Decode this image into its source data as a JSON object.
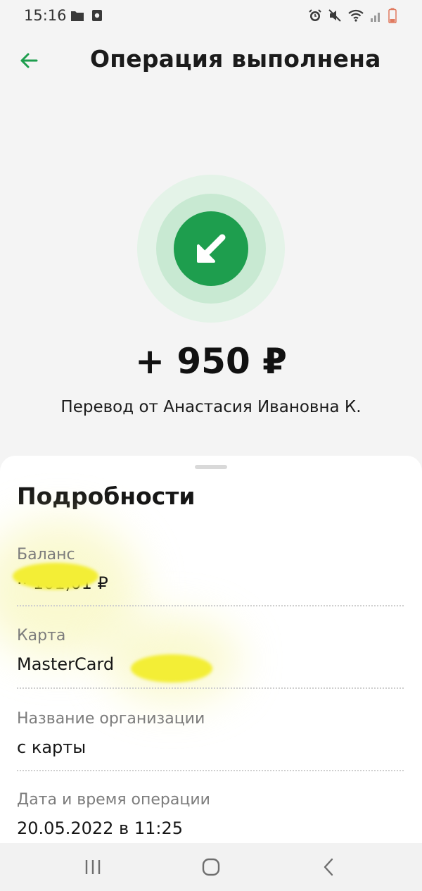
{
  "status": {
    "time": "15:16",
    "left_icons": [
      "folder-icon",
      "media-icon"
    ],
    "right_icons": [
      "alarm-icon",
      "mute-icon",
      "wifi-icon",
      "signal-icon",
      "battery-icon"
    ]
  },
  "header": {
    "back_icon": "arrow-left-icon",
    "title": "Операция выполнена"
  },
  "hero": {
    "icon": "incoming-arrow-icon",
    "amount": "+ 950 ₽",
    "subtitle": "Перевод от Анастасия Ивановна К."
  },
  "details": {
    "title": "Подробности",
    "rows": [
      {
        "label": "Баланс",
        "value": "·· 101,01 ₽"
      },
      {
        "label": "Карта",
        "value": "MasterCard"
      },
      {
        "label": "Название организации",
        "value": "с карты"
      },
      {
        "label": "Дата и время операции",
        "value": "20.05.2022 в 11:25"
      }
    ]
  },
  "navbar": {
    "recents_icon": "recents-icon",
    "home_icon": "home-icon",
    "back_icon": "back-icon"
  },
  "colors": {
    "accent": "#1e9e4e",
    "background": "#f4f4f4",
    "highlight": "#f3ee36"
  }
}
